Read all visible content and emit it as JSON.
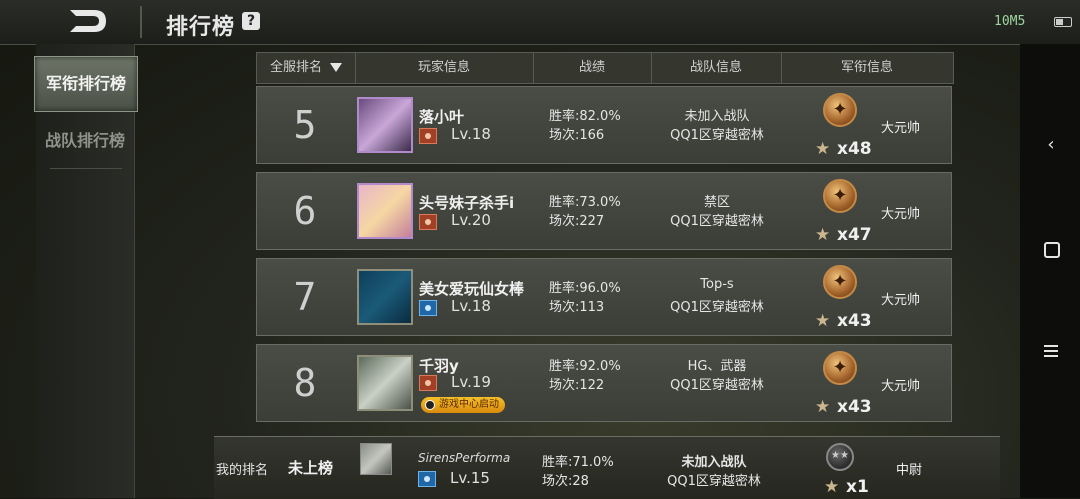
{
  "header": {
    "title": "排行榜",
    "help": "?",
    "status_text": "10M5"
  },
  "sidebar": {
    "items": [
      {
        "label": "军衔排行榜",
        "active": true
      },
      {
        "label": "战队排行榜",
        "active": false
      }
    ]
  },
  "table": {
    "columns": [
      "全服排名",
      "玩家信息",
      "战绩",
      "战队信息",
      "军衔信息"
    ]
  },
  "rows": [
    {
      "rank": "5",
      "name": "落小叶",
      "level": "Lv.18",
      "win_rate": "胜率:82.0%",
      "matches": "场次:166",
      "team": "未加入战队",
      "region": "QQ1区穿越密林",
      "star_count": "x48",
      "mil_rank": "大元帅",
      "rank_icon_color": "#a24026"
    },
    {
      "rank": "6",
      "name": "头号妹子杀手i",
      "level": "Lv.20",
      "win_rate": "胜率:73.0%",
      "matches": "场次:227",
      "team": "禁区",
      "region": "QQ1区穿越密林",
      "star_count": "x47",
      "mil_rank": "大元帅",
      "rank_icon_color": "#a24026"
    },
    {
      "rank": "7",
      "name": "美女爱玩仙女棒",
      "level": "Lv.18",
      "win_rate": "胜率:96.0%",
      "matches": "场次:113",
      "team": "Top-s",
      "region": "QQ1区穿越密林",
      "star_count": "x43",
      "mil_rank": "大元帅",
      "rank_icon_color": "#1f67a6"
    },
    {
      "rank": "8",
      "name": "千羽y",
      "level": "Lv.19",
      "win_rate": "胜率:92.0%",
      "matches": "场次:122",
      "team": "HG、武器",
      "region": "QQ1区穿越密林",
      "star_count": "x43",
      "mil_rank": "大元帅",
      "rank_icon_color": "#a24026",
      "badge": "游戏中心启动"
    }
  ],
  "my_rank": {
    "label": "我的排名",
    "value": "未上榜",
    "name": "SirensPerforma",
    "level": "Lv.15",
    "win_rate": "胜率:71.0%",
    "matches": "场次:28",
    "team": "未加入战队",
    "region": "QQ1区穿越密林",
    "star_count": "x1",
    "mil_rank": "中尉"
  }
}
